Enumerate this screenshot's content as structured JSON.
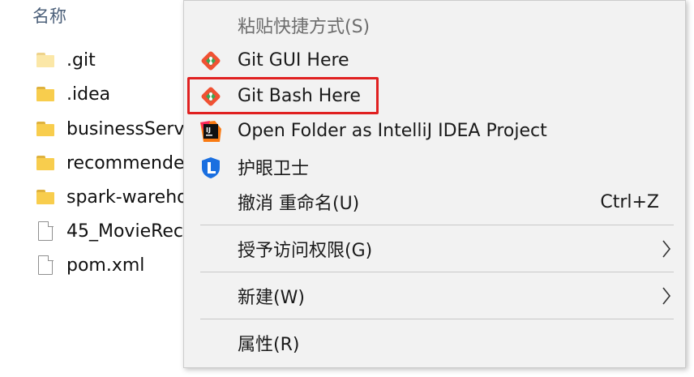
{
  "explorer": {
    "column_header": "名称",
    "items": [
      {
        "name": ".git",
        "icon": "folder-icon"
      },
      {
        "name": ".idea",
        "icon": "folder-icon"
      },
      {
        "name": "businessServ",
        "icon": "folder-icon"
      },
      {
        "name": "recommende",
        "icon": "folder-icon"
      },
      {
        "name": "spark-wareho",
        "icon": "folder-icon"
      },
      {
        "name": "45_MovieRec",
        "icon": "file-icon"
      },
      {
        "name": "pom.xml",
        "icon": "file-icon"
      }
    ]
  },
  "context_menu": {
    "paste_shortcut": "粘贴快捷方式(S)",
    "git_gui": "Git GUI Here",
    "git_bash": "Git Bash Here",
    "intellij": "Open Folder as IntelliJ IDEA Project",
    "eye_guard": "护眼卫士",
    "undo_rename": "撤消 重命名(U)",
    "undo_shortcut": "Ctrl+Z",
    "grant_access": "授予访问权限(G)",
    "new": "新建(W)",
    "properties": "属性(R)"
  },
  "colors": {
    "highlight_border": "#e02020",
    "menu_background": "#f2f2f2",
    "folder_yellow": "#f8cd4d"
  }
}
